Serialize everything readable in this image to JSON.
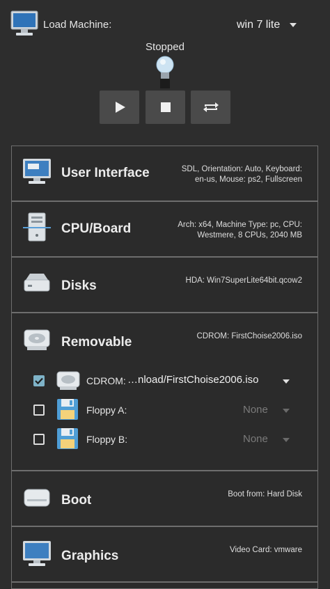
{
  "header": {
    "load_label": "Load Machine:",
    "machine": "win 7 lite",
    "status": "Stopped"
  },
  "controls": {
    "play_icon": "play-icon",
    "stop_icon": "stop-icon",
    "restart_icon": "restart-icon"
  },
  "sections": {
    "ui": {
      "title": "User Interface",
      "summary_1": "SDL, Orientation: Auto, Keyboard:",
      "summary_2": "en-us, Mouse: ps2, Fullscreen"
    },
    "cpu": {
      "title": "CPU/Board",
      "summary_1": "Arch: x64, Machine Type: pc, CPU:",
      "summary_2": "Westmere, 8 CPUs, 2040 MB"
    },
    "disks": {
      "title": "Disks",
      "summary": "HDA: Win7SuperLite64bit.qcow2"
    },
    "removable": {
      "title": "Removable",
      "summary": "CDROM: FirstChoise2006.iso",
      "rows": [
        {
          "label": "CDROM:",
          "value": "…nload/FirstChoise2006.iso",
          "checked": true
        },
        {
          "label": "Floppy A:",
          "value": "None",
          "checked": false
        },
        {
          "label": "Floppy B:",
          "value": "None",
          "checked": false
        }
      ]
    },
    "boot": {
      "title": "Boot",
      "summary": "Boot from: Hard Disk"
    },
    "graphics": {
      "title": "Graphics",
      "summary": "Video Card: vmware"
    }
  },
  "colors": {
    "background": "#2d2d2d",
    "border": "#6e6e6e",
    "button": "#4a4a4a",
    "check": "#7fb3c8"
  }
}
